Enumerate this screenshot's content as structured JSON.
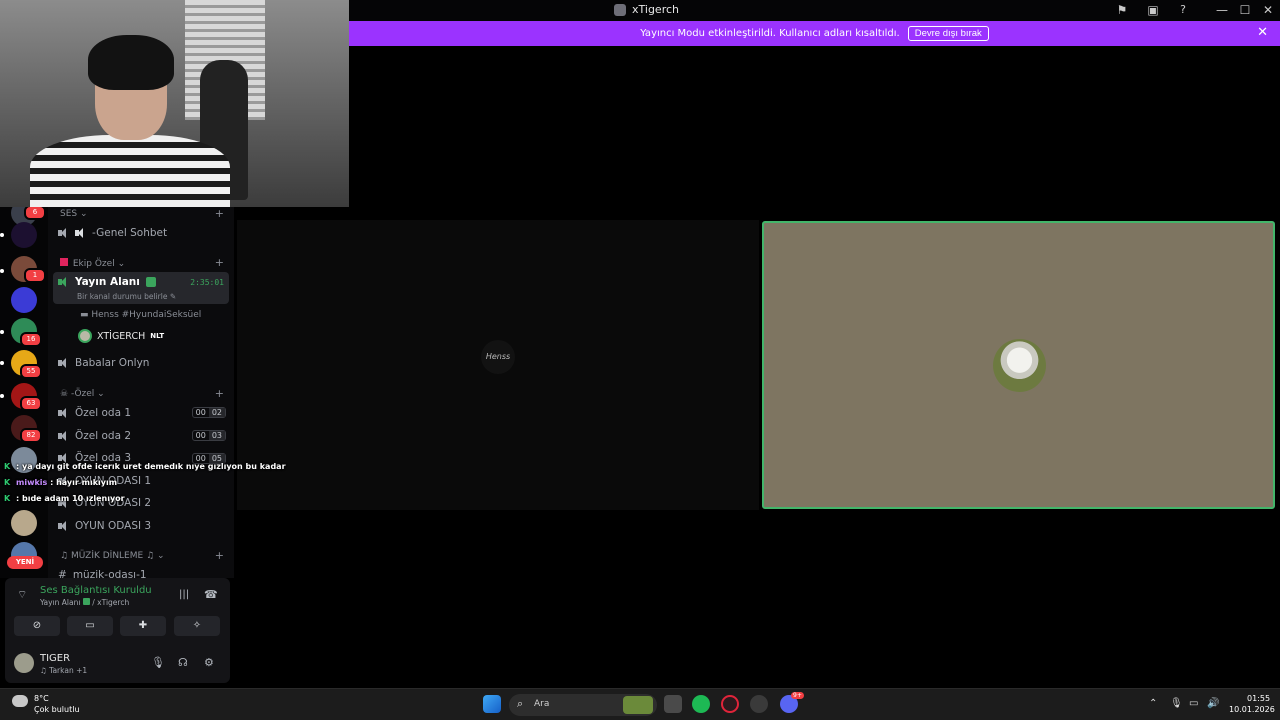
{
  "window": {
    "title": "xTigerch",
    "controls": {
      "minimize": "—",
      "maximize": "☐",
      "close": "✕"
    },
    "toolbar_icons": [
      "flag-icon",
      "inbox-icon",
      "help-icon"
    ]
  },
  "banner": {
    "message": "Yayıncı Modu etkinleştirildi. Kullanıcı adları kısaltıldı.",
    "button_label": "Devre dışı bırak",
    "color": "#9b33ff"
  },
  "servers": {
    "badges": [
      "6",
      "1",
      "16",
      "55",
      "63",
      "82"
    ],
    "new_label": "YENİ"
  },
  "channels": {
    "categories": [
      {
        "label": "SES",
        "chevron": "⌄"
      },
      {
        "label": "Ekip Özel",
        "chevron": "⌄"
      },
      {
        "label": "-Özel",
        "chevron": "⌄"
      },
      {
        "label": "MÜZİK DİNLEME",
        "chevron": "⌄"
      }
    ],
    "genel": "-Genel Sohbet",
    "active": {
      "name": "Yayın Alanı",
      "timer": "2:35:01",
      "status": "Bir kanal durumu belirle",
      "members": [
        {
          "name": "Henss #HyundaiSeksüel"
        },
        {
          "name": "XTİGERCH",
          "tag": "NLT"
        }
      ]
    },
    "babalar": "Babalar Onlyn",
    "private": [
      {
        "name": "Özel oda 1",
        "count_a": "00",
        "count_b": "02"
      },
      {
        "name": "Özel oda 2",
        "count_a": "00",
        "count_b": "03"
      },
      {
        "name": "Özel oda 3",
        "count_a": "00",
        "count_b": "05"
      }
    ],
    "game_rooms": [
      "OYUN ODASI 1",
      "OYUN ODASI 2",
      "OYUN ODASI 3"
    ],
    "music_room": "müzik-odası-1"
  },
  "chat_overlay": [
    {
      "prefix": "K",
      "user": "",
      "text": ": ya dayı git ofde icerık uret demedık nıye gızlıyon bu kadar"
    },
    {
      "prefix": "K",
      "user": "miwkis",
      "text": ": hayır mıkıyım"
    },
    {
      "prefix": "K",
      "user": "",
      "text": ": bıde adam 10 ızlenıyor"
    }
  ],
  "voice": {
    "status": "Ses Bağlantısı Kuruldu",
    "channel": "Yayın Alanı",
    "separator": "/",
    "server": "xTigerch",
    "buttons": [
      "camera-off-icon",
      "screen-share-icon",
      "activities-icon",
      "soundboard-icon"
    ]
  },
  "user": {
    "name": "TIGER",
    "activity": "Tarkan +1"
  },
  "stage": {
    "left_tile_label": "Henss",
    "speaking_color": "#43b56a"
  },
  "taskbar": {
    "weather_temp": "8°C",
    "weather_desc": "Çok bulutlu",
    "search_placeholder": "Ara",
    "time": "01:55",
    "date": "10.01.2026",
    "discord_badge": "9+"
  }
}
